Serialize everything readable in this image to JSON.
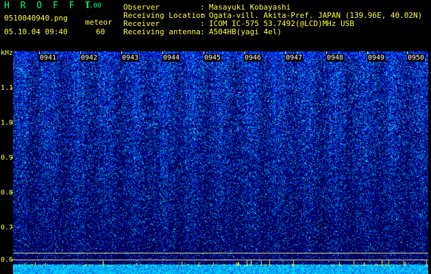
{
  "app": {
    "title": "H R O F F T",
    "version": "1.00"
  },
  "file": {
    "name": "0510040940.png",
    "date_time": "05.10.04 09:40"
  },
  "meteor": {
    "label": "meteor",
    "count": "60"
  },
  "info": [
    {
      "label": "Observer",
      "value": "Masayuki Kobayashi"
    },
    {
      "label": "Receiving Location",
      "value": "Ogata-vill. Akita-Pref. JAPAN (139.96E, 40.02N)"
    },
    {
      "label": "Receiver",
      "value": "ICOM IC-575 53.7492(@LCD)MHz USB"
    },
    {
      "label": "Receiving antenna",
      "value": "A504HB(yagi 4el)"
    }
  ],
  "colon": ":",
  "axis": {
    "unit": "kHz",
    "y_ticks": [
      "1.1",
      "1.0",
      "0.9",
      "0.8",
      "0.7",
      "0.6"
    ],
    "y_range": [
      0.6,
      1.1
    ],
    "x_ticks": [
      "0941",
      "0942",
      "0943",
      "0944",
      "0945",
      "0946",
      "0947",
      "0948",
      "0949",
      "0950"
    ]
  },
  "colors": {
    "header_text": "#ffff40",
    "title_text": "#00ff80",
    "background": "#000000",
    "spectrogram_low": "#000060",
    "spectrogram_mid": "#0040ff",
    "spectrogram_high": "#00ffff",
    "baseline": "#ffff00"
  }
}
